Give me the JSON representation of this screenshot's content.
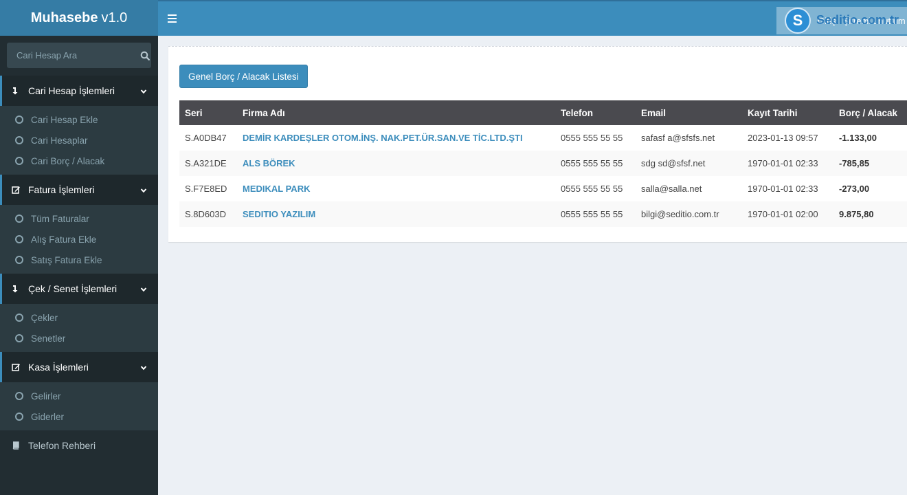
{
  "brand": {
    "bold": "Muhasebe",
    "version": "v1.0"
  },
  "topbar": {
    "links": [
      "Giriş",
      "Şifremi unuttum"
    ],
    "watermark_text": "Seditio.com.tr",
    "watermark_initial": "S"
  },
  "sidebar": {
    "search_placeholder": "Cari Hesap Ara",
    "groups": [
      {
        "label": "Cari Hesap İşlemleri",
        "icon": "arrow-down-icon",
        "items": [
          "Cari Hesap Ekle",
          "Cari Hesaplar",
          "Cari Borç / Alacak"
        ]
      },
      {
        "label": "Fatura İşlemleri",
        "icon": "edit-icon",
        "items": [
          "Tüm Faturalar",
          "Alış Fatura Ekle",
          "Satış Fatura Ekle"
        ]
      },
      {
        "label": "Çek / Senet İşlemleri",
        "icon": "arrow-down-icon",
        "items": [
          "Çekler",
          "Senetler"
        ]
      },
      {
        "label": "Kasa İşlemleri",
        "icon": "edit-icon",
        "items": [
          "Gelirler",
          "Giderler"
        ]
      }
    ],
    "phonebook": {
      "label": "Telefon Rehberi",
      "icon": "book-icon"
    }
  },
  "main": {
    "button_label": "Genel Borç / Alacak Listesi",
    "table": {
      "columns": [
        "Seri",
        "Firma Adı",
        "Telefon",
        "Email",
        "Kayıt Tarihi",
        "Borç / Alacak"
      ],
      "rows": [
        [
          "S.A0DB47",
          "DEMİR KARDEŞLER OTOM.İNŞ. NAK.PET.ÜR.SAN.VE TİC.LTD.ŞTI",
          "0555 555 55 55",
          "safasf a@sfsfs.net",
          "2023-01-13 09:57",
          "-1.133,00"
        ],
        [
          "S.A321DE",
          "ALS BÖREK",
          "0555 555 55 55",
          "sdg sd@sfsf.net",
          "1970-01-01 02:33",
          "-785,85"
        ],
        [
          "S.F7E8ED",
          "MEDIKAL PARK",
          "0555 555 55 55",
          "salla@salla.net",
          "1970-01-01 02:33",
          "-273,00"
        ],
        [
          "S.8D603D",
          "SEDITIO YAZILIM",
          "0555 555 55 55",
          "bilgi@seditio.com.tr",
          "1970-01-01 02:00",
          "9.875,80"
        ]
      ]
    }
  },
  "colors": {
    "header": "#3c8dbc",
    "logo_bg": "#357ca5",
    "sidebar": "#222d32",
    "accent": "#3c8dbc"
  }
}
